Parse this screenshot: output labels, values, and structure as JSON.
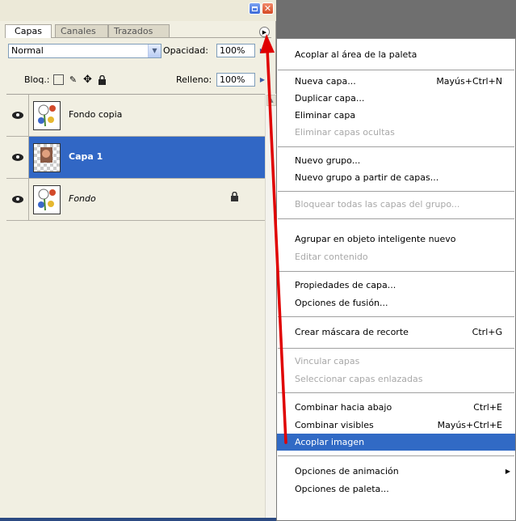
{
  "palette": {
    "tabs": [
      {
        "label": "Capas"
      },
      {
        "label": "Canales"
      },
      {
        "label": "Trazados"
      }
    ],
    "blend_mode": "Normal",
    "opacity_label": "Opacidad:",
    "opacity_value": "100%",
    "lock_label": "Bloq.:",
    "fill_label": "Relleno:",
    "fill_value": "100%",
    "layers": [
      {
        "name": "Fondo copia"
      },
      {
        "name": "Capa 1"
      },
      {
        "name": "Fondo"
      }
    ]
  },
  "menu": {
    "items": [
      {
        "label": "Acoplar al área de la paleta",
        "shortcut": ""
      },
      {
        "label": "Nueva capa...",
        "shortcut": "Mayús+Ctrl+N"
      },
      {
        "label": "Duplicar capa...",
        "shortcut": ""
      },
      {
        "label": "Eliminar capa",
        "shortcut": ""
      },
      {
        "label": "Eliminar capas ocultas",
        "shortcut": ""
      },
      {
        "label": "Nuevo grupo...",
        "shortcut": ""
      },
      {
        "label": "Nuevo grupo a partir de capas...",
        "shortcut": ""
      },
      {
        "label": "Bloquear todas las capas del grupo...",
        "shortcut": ""
      },
      {
        "label": "Agrupar en objeto inteligente nuevo",
        "shortcut": ""
      },
      {
        "label": "Editar contenido",
        "shortcut": ""
      },
      {
        "label": "Propiedades de capa...",
        "shortcut": ""
      },
      {
        "label": "Opciones de fusión...",
        "shortcut": ""
      },
      {
        "label": "Crear máscara de recorte",
        "shortcut": "Ctrl+G"
      },
      {
        "label": "Vincular capas",
        "shortcut": ""
      },
      {
        "label": "Seleccionar capas enlazadas",
        "shortcut": ""
      },
      {
        "label": "Combinar hacia abajo",
        "shortcut": "Ctrl+E"
      },
      {
        "label": "Combinar visibles",
        "shortcut": "Mayús+Ctrl+E"
      },
      {
        "label": "Acoplar imagen",
        "shortcut": ""
      },
      {
        "label": "Opciones de animación",
        "shortcut": ""
      },
      {
        "label": "Opciones de paleta...",
        "shortcut": ""
      }
    ]
  },
  "colors": {
    "selection": "#316ac5",
    "annotation_arrow": "#e00000"
  }
}
